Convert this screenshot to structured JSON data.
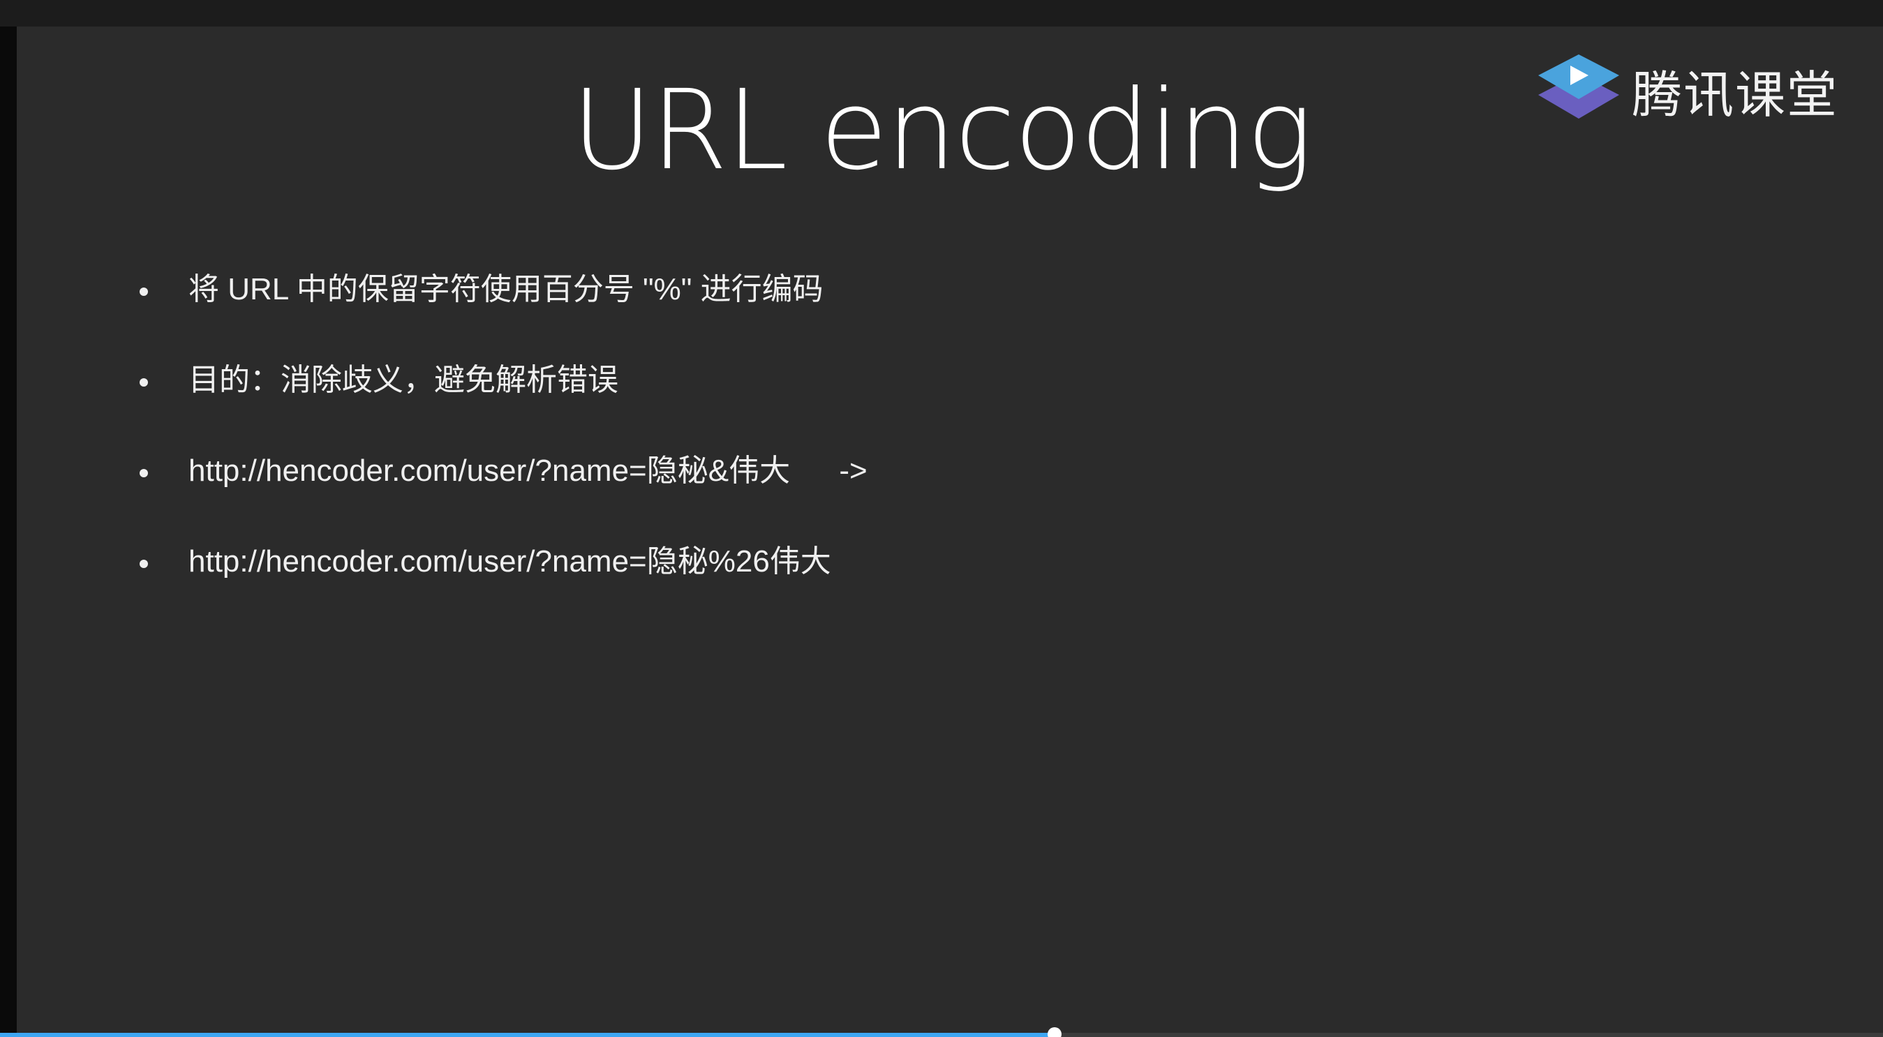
{
  "slide": {
    "title": "URL encoding",
    "logo_text": "腾讯课堂",
    "bullets": [
      {
        "text": "将 URL 中的保留字符使用百分号 \"%\" 进行编码",
        "suffix": ""
      },
      {
        "text": "目的：消除歧义，避免解析错误",
        "suffix": ""
      },
      {
        "text": "http://hencoder.com/user/?name=隐秘&伟大",
        "suffix": "->"
      },
      {
        "text": "http://hencoder.com/user/?name=隐秘%26伟大",
        "suffix": ""
      }
    ]
  },
  "player": {
    "progress_fraction": 0.56
  },
  "colors": {
    "slide_background": "#2b2b2b",
    "logo_blue": "#4aa3dd",
    "logo_purple": "#6a5fc0",
    "progress_fill": "#3ea6f2"
  }
}
